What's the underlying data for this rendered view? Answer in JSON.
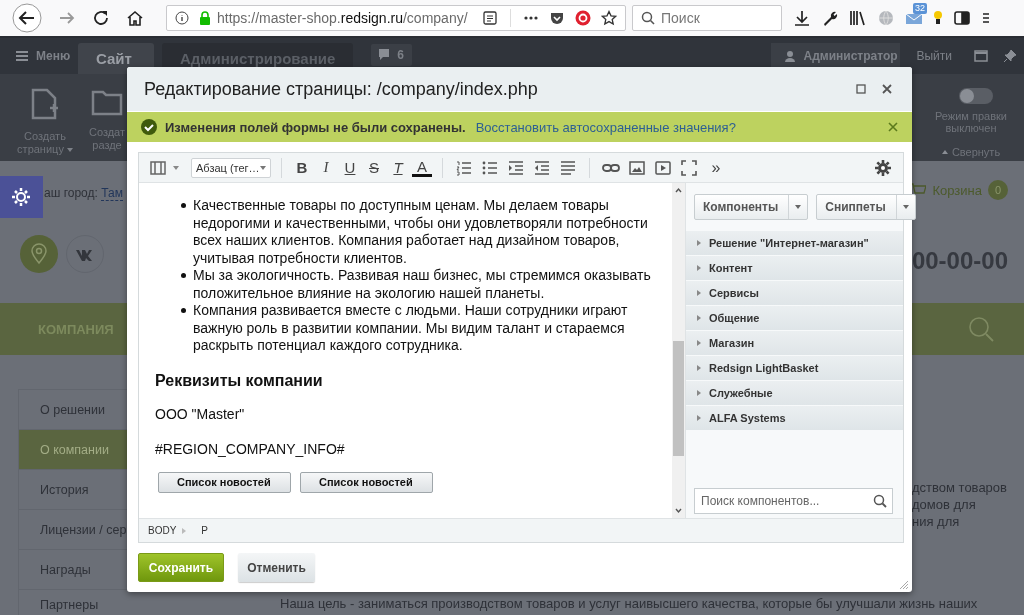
{
  "browser": {
    "url": {
      "scheme": "https://master-shop.",
      "domain": "redsign.ru",
      "path": "/company/"
    },
    "search": {
      "placeholder": "Поиск"
    },
    "mail_badge": "32"
  },
  "admin": {
    "menu": "Меню",
    "tabs": [
      {
        "label": "Сайт",
        "selected": true
      },
      {
        "label": "Администрирование",
        "selected": false
      }
    ],
    "notifications": "6",
    "user": "Администратор",
    "logout": "Выйти",
    "actions": [
      {
        "kind": "page",
        "lines": [
          "Создать",
          "страницу"
        ],
        "has_menu": true
      },
      {
        "kind": "folder",
        "lines": [
          "Создат",
          "разде"
        ],
        "has_menu": false
      }
    ],
    "edit_mode": {
      "label": "Режим правки выключен",
      "on": false
    },
    "collapse": "Свернуть"
  },
  "site": {
    "city_label": "аш город:",
    "city": "Там",
    "cart": "Корзина",
    "cart_count": "0",
    "phone": "00-00-00",
    "nav": "КОМПАНИЯ",
    "sidebar": [
      {
        "label": "О решении",
        "selected": false
      },
      {
        "label": "О компании",
        "selected": true
      },
      {
        "label": "История",
        "selected": false
      },
      {
        "label": "Лицензии / сер",
        "selected": false
      },
      {
        "label": "Награды",
        "selected": false
      },
      {
        "label": "Партнеры",
        "selected": false
      }
    ],
    "side_text": [
      "дством товаров",
      "домов для",
      "ния для"
    ],
    "bottom_text": "Наша цель - заниматься производством товаров и услуг наивысшего качества, которые бы улучшали жизнь наших"
  },
  "dialog": {
    "title": "Редактирование страницы: /company/index.php",
    "notice": {
      "message": "Изменения полей формы не были сохранены.",
      "link": "Восстановить автосохраненные значения?"
    },
    "toolbar": {
      "format": "Абзац (тег…",
      "text_buttons": [
        {
          "kind": "bold",
          "label": "B"
        },
        {
          "kind": "italic",
          "label": "I"
        },
        {
          "kind": "underline",
          "label": "U"
        },
        {
          "kind": "strike",
          "label": "S"
        },
        {
          "kind": "clear",
          "label": "T"
        },
        {
          "kind": "color",
          "label": "A"
        }
      ],
      "more": "»"
    },
    "content": [
      {
        "kind": "list",
        "items": [
          "Качественные товары по доступным ценам. Мы делаем товары недорогими и качественными, чтобы они удовлетворяли потребности всех наших клиентов. Компания работает над дизайном товаров, учитывая потребности клиентов.",
          "Мы за экологичность. Развивая наш бизнес, мы стремимся оказывать положительное влияние на экологию нашей планеты.",
          "Компания развивается вместе с людьми. Наши сотрудники играют важную роль в развитии компании. Мы видим талант и стараемся раскрыть потенциал каждого сотрудника."
        ]
      },
      {
        "kind": "heading",
        "text": "Реквизиты компании"
      },
      {
        "kind": "paragraph",
        "text": "ООО \"Master\""
      },
      {
        "kind": "paragraph",
        "text": "#REGION_COMPANY_INFO#"
      },
      {
        "kind": "components",
        "items": [
          "Список новостей",
          "Список новостей"
        ]
      }
    ],
    "path": [
      "BODY",
      "P"
    ],
    "panel": {
      "buttons": [
        "Компоненты",
        "Сниппеты"
      ],
      "groups": [
        "Решение \"Интернет-магазин\"",
        "Контент",
        "Сервисы",
        "Общение",
        "Магазин",
        "Redsign LightBasket",
        "Служебные",
        "ALFA Systems"
      ],
      "search": {
        "placeholder": "Поиск компонентов..."
      }
    },
    "save": "Сохранить",
    "cancel": "Отменить"
  }
}
